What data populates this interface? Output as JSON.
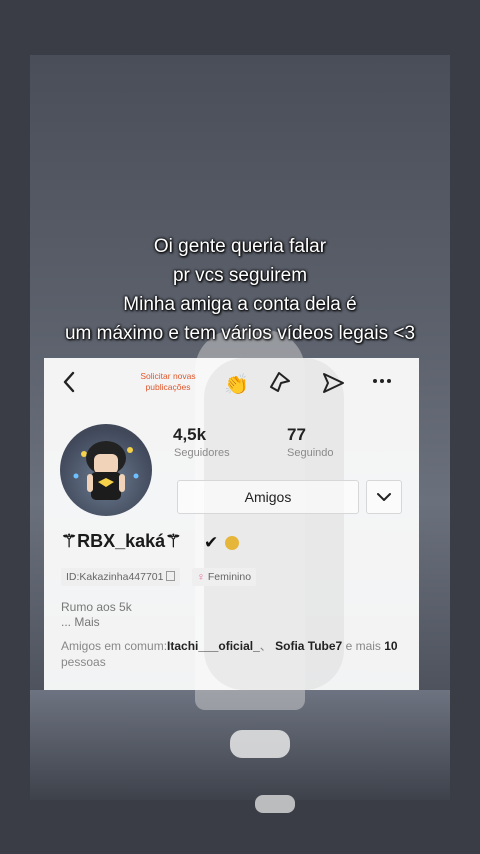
{
  "caption": {
    "line1": "Oi gente queria falar",
    "line2": "pr vcs seguirem",
    "line3": "Minha amiga a conta dela é",
    "line4": "um máximo e tem vários vídeos legais <3"
  },
  "profile_card": {
    "header": {
      "back_icon": "chevron-left-icon",
      "solicitar_label": "Solicitar novas publicações",
      "emoji_icon": "👏",
      "star_icon": "star-outline-icon",
      "share_icon": "share-icon",
      "more_icon": "more-dots-icon"
    },
    "stats": {
      "followers_value": "4,5k",
      "followers_label": "Seguidores",
      "following_value": "77",
      "following_label": "Seguindo"
    },
    "friends_button_label": "Amigos",
    "dropdown_icon": "chevron-down-icon",
    "username": "⚚RBX_kaká⚚",
    "verified_mark": "✔",
    "id_tag": "ID:Kakazinha447701",
    "gender_tag": "Feminino",
    "bio_line1": "Rumo aos 5k",
    "bio_more": "...  Mais",
    "common_friends": {
      "prefix": "Amigos em comum:",
      "friend1": "Itachi___oficial_",
      "separator": "、",
      "friend2": "Sofia Tube7",
      "middle": " e mais ",
      "count": "10",
      "suffix": "pessoas"
    }
  },
  "colors": {
    "accent_orange": "#e0572b",
    "gender_pink": "#e8629a"
  }
}
